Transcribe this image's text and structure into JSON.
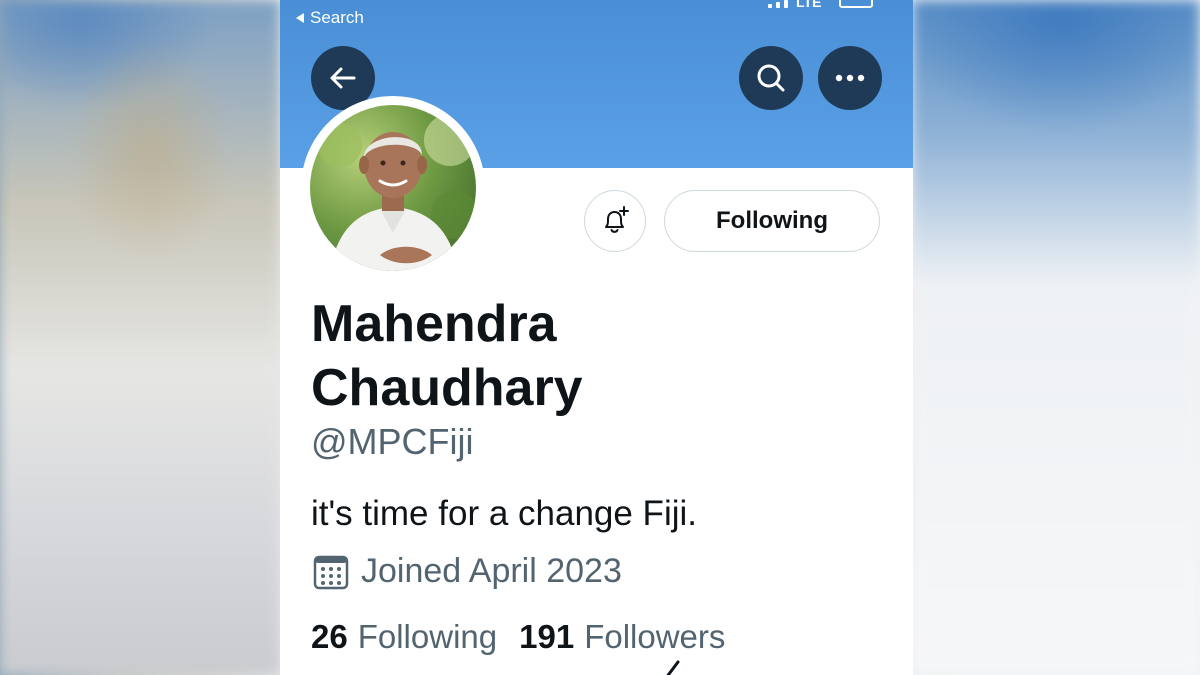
{
  "status_bar": {
    "back_label": "Search",
    "network": "LTE"
  },
  "colors": {
    "banner": "#4a8fd6",
    "header_button": "#1f3a57",
    "text_primary": "#0f1419",
    "text_secondary": "#536471"
  },
  "header": {
    "back_icon": "arrow-left-icon",
    "search_icon": "search-icon",
    "more_icon": "more-dots-icon"
  },
  "profile": {
    "notify_icon": "bell-plus-icon",
    "following_button": "Following",
    "name_line1": "Mahendra",
    "name_line2": "Chaudhary",
    "handle": "@MPCFiji",
    "bio": "it's time for a change Fiji.",
    "joined": "Joined April 2023",
    "joined_icon": "calendar-icon",
    "following_count": "26",
    "following_label": "Following",
    "followers_count": "191",
    "followers_label": "Followers"
  }
}
